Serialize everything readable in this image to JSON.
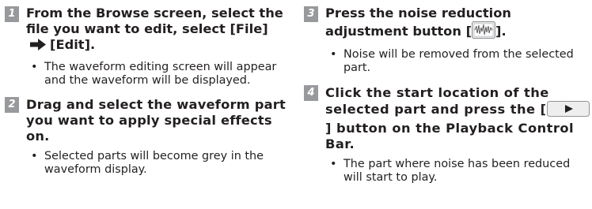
{
  "steps": [
    {
      "number": "1",
      "title_part1": "From the Browse screen, select the file you want to edit, select [File]",
      "arrow_icon": "right-arrow-icon",
      "title_part2": "[Edit].",
      "bullet": "The waveform editing screen will appear and the waveform will be displayed."
    },
    {
      "number": "2",
      "title": "Drag and select the waveform part you want to apply special effects on.",
      "bullet": "Selected parts will become grey in the waveform display."
    },
    {
      "number": "3",
      "title_part1": "Press the noise reduction adjustment button [",
      "button_icon": "noise-reduction-icon",
      "title_part2": "].",
      "bullet": "Noise will be removed from the selected part."
    },
    {
      "number": "4",
      "title_part1": "Click the start location of the selected part and press the [",
      "button_icon": "play-button-icon",
      "title_part2": "] button on the Playback Control Bar.",
      "bullet": "The part where noise has been reduced will start to play."
    }
  ],
  "bullet_symbol": "•",
  "colors": {
    "text": "#231f20",
    "step_number_bg": "#98999c",
    "step_number_text": "#ffffff"
  }
}
